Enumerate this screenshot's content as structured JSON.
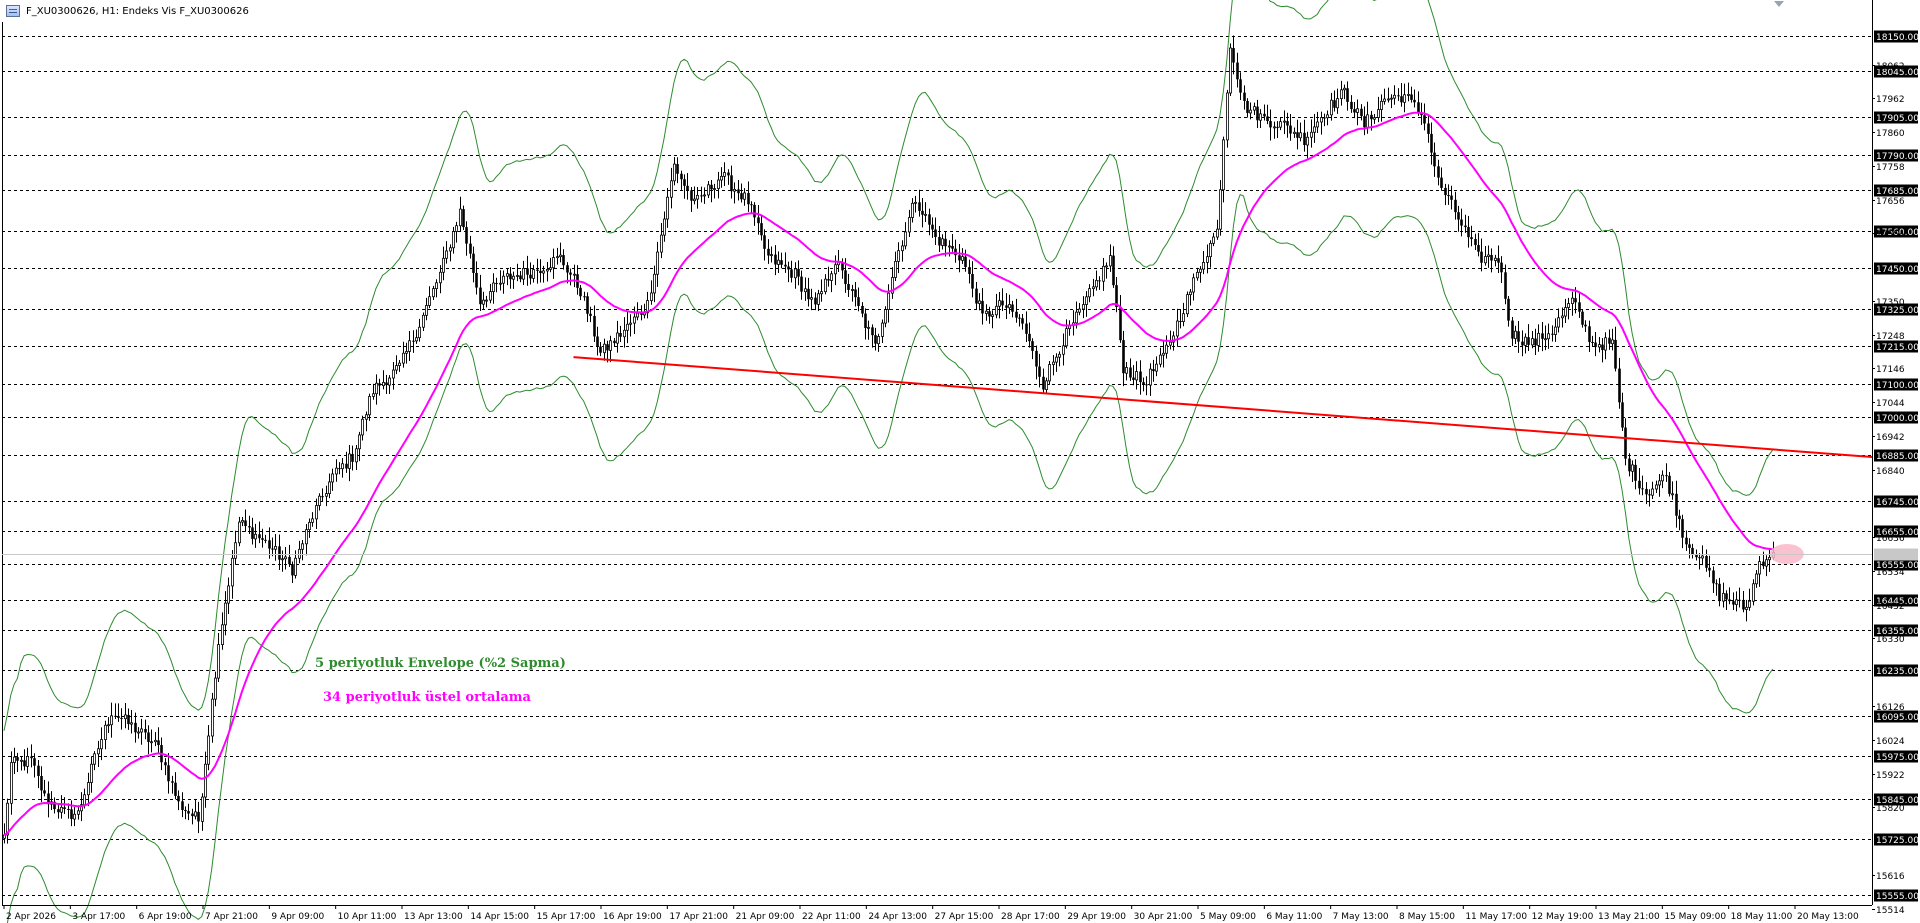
{
  "window": {
    "title": "F_XU0300626, H1:  Endeks Vis F_XU0300626"
  },
  "colors": {
    "candle": "#000000",
    "envelope": "#2e8b2e",
    "ema": "#ff00ff",
    "trendline": "#ff0000",
    "level_line": "#000000",
    "price_tag_bg": "#000000",
    "highlight": "#f9b7c9"
  },
  "annotations": {
    "envelope_label": "5 periyotluk Envelope (%2 Sapma)",
    "ema_label": "34 periyotluk üstel ortalama"
  },
  "chart_data": {
    "type": "candlestick",
    "symbol": "F_XU0300626",
    "timeframe": "H1",
    "ylim": [
      15460,
      18230
    ],
    "grid": false,
    "price_axis_ticks": [
      "18062",
      "17962",
      "17860",
      "17758",
      "17656",
      "17554",
      "17350",
      "17248",
      "17146",
      "17044",
      "16942",
      "16840",
      "16636",
      "16534",
      "16432",
      "16330",
      "16126",
      "16024",
      "15922",
      "15820",
      "15616",
      "15514"
    ],
    "level_lines": [
      18150,
      18045,
      17905,
      17790,
      17685,
      17560,
      17450,
      17325,
      17215,
      17100,
      17000,
      16885,
      16745,
      16655,
      16555,
      16445,
      16355,
      16235,
      16095,
      15975,
      15845,
      15725,
      15555
    ],
    "level_labels": [
      "18150.00",
      "18045.00",
      "17905.00",
      "17790.00",
      "17685.00",
      "17560.00",
      "17450.00",
      "17325.00",
      "17215.00",
      "17100.00",
      "17000.00",
      "16885.00",
      "16745.00",
      "16655.00",
      "16555.00",
      "16445.00",
      "16355.00",
      "16235.00",
      "16095.00",
      "15975.00",
      "15845.00",
      "15725.00",
      "15555.00"
    ],
    "current_price": 16585,
    "x_labels": [
      "2 Apr 2026",
      "3 Apr 17:00",
      "6 Apr 19:00",
      "7 Apr 21:00",
      "9 Apr 09:00",
      "10 Apr 11:00",
      "13 Apr 13:00",
      "14 Apr 15:00",
      "15 Apr 17:00",
      "16 Apr 19:00",
      "17 Apr 21:00",
      "21 Apr 09:00",
      "22 Apr 11:00",
      "24 Apr 13:00",
      "27 Apr 15:00",
      "28 Apr 17:00",
      "29 Apr 19:00",
      "30 Apr 21:00",
      "5 May 09:00",
      "6 May 11:00",
      "7 May 13:00",
      "8 May 15:00",
      "11 May 17:00",
      "12 May 19:00",
      "13 May 21:00",
      "15 May 09:00",
      "18 May 11:00",
      "20 May 13:00"
    ],
    "close_anchors": [
      [
        0,
        15730
      ],
      [
        2,
        15950
      ],
      [
        8,
        15960
      ],
      [
        12,
        15850
      ],
      [
        18,
        15800
      ],
      [
        22,
        15800
      ],
      [
        28,
        16000
      ],
      [
        32,
        16110
      ],
      [
        40,
        16050
      ],
      [
        46,
        16000
      ],
      [
        52,
        15830
      ],
      [
        58,
        15780
      ],
      [
        64,
        16320
      ],
      [
        70,
        16680
      ],
      [
        78,
        16620
      ],
      [
        86,
        16540
      ],
      [
        92,
        16700
      ],
      [
        98,
        16820
      ],
      [
        104,
        16880
      ],
      [
        110,
        17080
      ],
      [
        118,
        17150
      ],
      [
        124,
        17280
      ],
      [
        130,
        17430
      ],
      [
        136,
        17620
      ],
      [
        142,
        17350
      ],
      [
        150,
        17420
      ],
      [
        158,
        17440
      ],
      [
        166,
        17480
      ],
      [
        172,
        17380
      ],
      [
        178,
        17190
      ],
      [
        186,
        17270
      ],
      [
        192,
        17340
      ],
      [
        200,
        17760
      ],
      [
        206,
        17640
      ],
      [
        214,
        17730
      ],
      [
        222,
        17650
      ],
      [
        228,
        17480
      ],
      [
        236,
        17430
      ],
      [
        242,
        17330
      ],
      [
        248,
        17470
      ],
      [
        254,
        17350
      ],
      [
        260,
        17210
      ],
      [
        266,
        17470
      ],
      [
        272,
        17660
      ],
      [
        278,
        17540
      ],
      [
        286,
        17480
      ],
      [
        292,
        17300
      ],
      [
        298,
        17340
      ],
      [
        304,
        17280
      ],
      [
        310,
        17100
      ],
      [
        316,
        17230
      ],
      [
        322,
        17330
      ],
      [
        330,
        17480
      ],
      [
        334,
        17150
      ],
      [
        340,
        17100
      ],
      [
        346,
        17180
      ],
      [
        352,
        17330
      ],
      [
        358,
        17480
      ],
      [
        362,
        17560
      ],
      [
        366,
        18130
      ],
      [
        370,
        17940
      ],
      [
        376,
        17900
      ],
      [
        382,
        17880
      ],
      [
        388,
        17840
      ],
      [
        394,
        17920
      ],
      [
        400,
        17980
      ],
      [
        406,
        17880
      ],
      [
        412,
        17960
      ],
      [
        418,
        17970
      ],
      [
        424,
        17900
      ],
      [
        428,
        17710
      ],
      [
        434,
        17600
      ],
      [
        440,
        17480
      ],
      [
        446,
        17480
      ],
      [
        450,
        17250
      ],
      [
        456,
        17220
      ],
      [
        462,
        17260
      ],
      [
        468,
        17350
      ],
      [
        474,
        17220
      ],
      [
        480,
        17220
      ],
      [
        484,
        16870
      ],
      [
        490,
        16770
      ],
      [
        496,
        16820
      ],
      [
        502,
        16620
      ],
      [
        506,
        16580
      ],
      [
        512,
        16460
      ],
      [
        520,
        16420
      ],
      [
        524,
        16560
      ],
      [
        528,
        16590
      ]
    ],
    "trendline": {
      "start": {
        "bar": 170,
        "price": 17180
      },
      "end": {
        "bar": 560,
        "price": 16878
      }
    },
    "indicators": [
      {
        "type": "envelope",
        "period": 5,
        "deviation_pct": 2
      },
      {
        "type": "ema",
        "period": 34
      }
    ]
  }
}
